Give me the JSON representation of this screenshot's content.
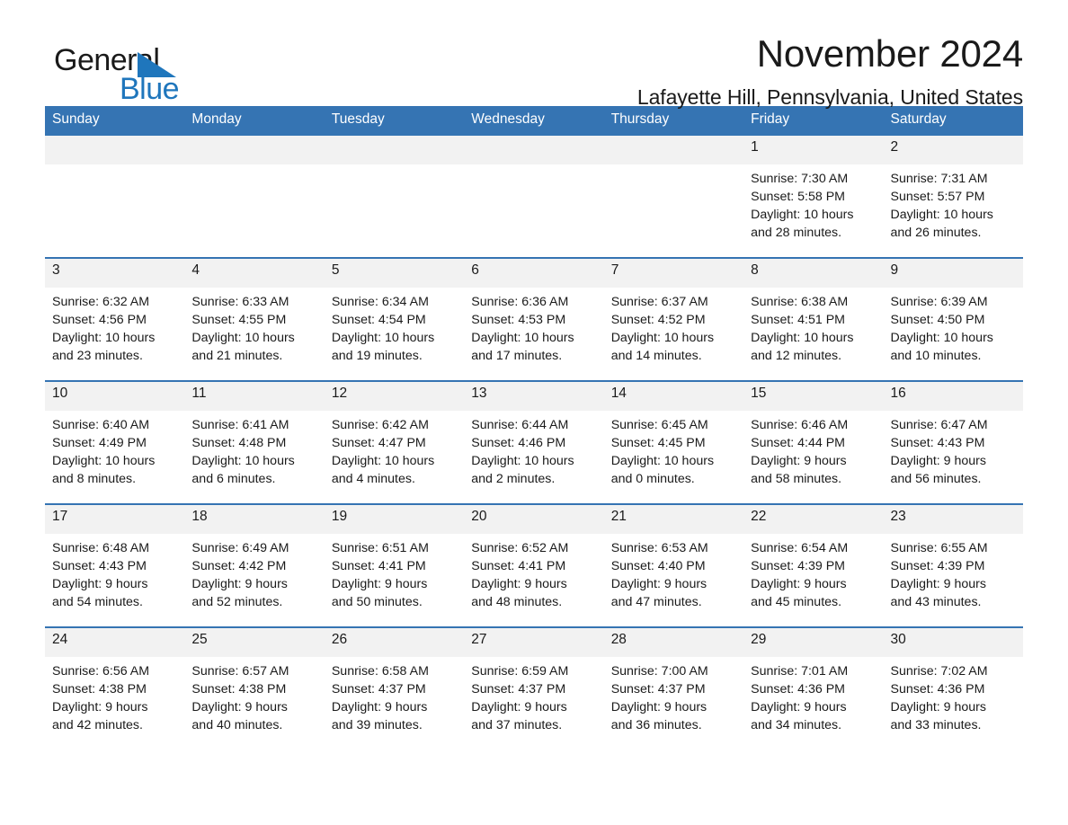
{
  "brand": {
    "name_part1": "General",
    "name_part2": "Blue",
    "accent_color": "#1f76bc",
    "triangle_icon": "triangle-icon"
  },
  "header": {
    "month_title": "November 2024",
    "location": "Lafayette Hill, Pennsylvania, United States"
  },
  "calendar": {
    "header_bg": "#3574b3",
    "daynum_bg": "#f2f2f2",
    "weekday_headers": [
      "Sunday",
      "Monday",
      "Tuesday",
      "Wednesday",
      "Thursday",
      "Friday",
      "Saturday"
    ],
    "weeks": [
      [
        {
          "day": "",
          "sunrise": "",
          "sunset": "",
          "daylight_line1": "",
          "daylight_line2": ""
        },
        {
          "day": "",
          "sunrise": "",
          "sunset": "",
          "daylight_line1": "",
          "daylight_line2": ""
        },
        {
          "day": "",
          "sunrise": "",
          "sunset": "",
          "daylight_line1": "",
          "daylight_line2": ""
        },
        {
          "day": "",
          "sunrise": "",
          "sunset": "",
          "daylight_line1": "",
          "daylight_line2": ""
        },
        {
          "day": "",
          "sunrise": "",
          "sunset": "",
          "daylight_line1": "",
          "daylight_line2": ""
        },
        {
          "day": "1",
          "sunrise": "Sunrise: 7:30 AM",
          "sunset": "Sunset: 5:58 PM",
          "daylight_line1": "Daylight: 10 hours",
          "daylight_line2": "and 28 minutes."
        },
        {
          "day": "2",
          "sunrise": "Sunrise: 7:31 AM",
          "sunset": "Sunset: 5:57 PM",
          "daylight_line1": "Daylight: 10 hours",
          "daylight_line2": "and 26 minutes."
        }
      ],
      [
        {
          "day": "3",
          "sunrise": "Sunrise: 6:32 AM",
          "sunset": "Sunset: 4:56 PM",
          "daylight_line1": "Daylight: 10 hours",
          "daylight_line2": "and 23 minutes."
        },
        {
          "day": "4",
          "sunrise": "Sunrise: 6:33 AM",
          "sunset": "Sunset: 4:55 PM",
          "daylight_line1": "Daylight: 10 hours",
          "daylight_line2": "and 21 minutes."
        },
        {
          "day": "5",
          "sunrise": "Sunrise: 6:34 AM",
          "sunset": "Sunset: 4:54 PM",
          "daylight_line1": "Daylight: 10 hours",
          "daylight_line2": "and 19 minutes."
        },
        {
          "day": "6",
          "sunrise": "Sunrise: 6:36 AM",
          "sunset": "Sunset: 4:53 PM",
          "daylight_line1": "Daylight: 10 hours",
          "daylight_line2": "and 17 minutes."
        },
        {
          "day": "7",
          "sunrise": "Sunrise: 6:37 AM",
          "sunset": "Sunset: 4:52 PM",
          "daylight_line1": "Daylight: 10 hours",
          "daylight_line2": "and 14 minutes."
        },
        {
          "day": "8",
          "sunrise": "Sunrise: 6:38 AM",
          "sunset": "Sunset: 4:51 PM",
          "daylight_line1": "Daylight: 10 hours",
          "daylight_line2": "and 12 minutes."
        },
        {
          "day": "9",
          "sunrise": "Sunrise: 6:39 AM",
          "sunset": "Sunset: 4:50 PM",
          "daylight_line1": "Daylight: 10 hours",
          "daylight_line2": "and 10 minutes."
        }
      ],
      [
        {
          "day": "10",
          "sunrise": "Sunrise: 6:40 AM",
          "sunset": "Sunset: 4:49 PM",
          "daylight_line1": "Daylight: 10 hours",
          "daylight_line2": "and 8 minutes."
        },
        {
          "day": "11",
          "sunrise": "Sunrise: 6:41 AM",
          "sunset": "Sunset: 4:48 PM",
          "daylight_line1": "Daylight: 10 hours",
          "daylight_line2": "and 6 minutes."
        },
        {
          "day": "12",
          "sunrise": "Sunrise: 6:42 AM",
          "sunset": "Sunset: 4:47 PM",
          "daylight_line1": "Daylight: 10 hours",
          "daylight_line2": "and 4 minutes."
        },
        {
          "day": "13",
          "sunrise": "Sunrise: 6:44 AM",
          "sunset": "Sunset: 4:46 PM",
          "daylight_line1": "Daylight: 10 hours",
          "daylight_line2": "and 2 minutes."
        },
        {
          "day": "14",
          "sunrise": "Sunrise: 6:45 AM",
          "sunset": "Sunset: 4:45 PM",
          "daylight_line1": "Daylight: 10 hours",
          "daylight_line2": "and 0 minutes."
        },
        {
          "day": "15",
          "sunrise": "Sunrise: 6:46 AM",
          "sunset": "Sunset: 4:44 PM",
          "daylight_line1": "Daylight: 9 hours",
          "daylight_line2": "and 58 minutes."
        },
        {
          "day": "16",
          "sunrise": "Sunrise: 6:47 AM",
          "sunset": "Sunset: 4:43 PM",
          "daylight_line1": "Daylight: 9 hours",
          "daylight_line2": "and 56 minutes."
        }
      ],
      [
        {
          "day": "17",
          "sunrise": "Sunrise: 6:48 AM",
          "sunset": "Sunset: 4:43 PM",
          "daylight_line1": "Daylight: 9 hours",
          "daylight_line2": "and 54 minutes."
        },
        {
          "day": "18",
          "sunrise": "Sunrise: 6:49 AM",
          "sunset": "Sunset: 4:42 PM",
          "daylight_line1": "Daylight: 9 hours",
          "daylight_line2": "and 52 minutes."
        },
        {
          "day": "19",
          "sunrise": "Sunrise: 6:51 AM",
          "sunset": "Sunset: 4:41 PM",
          "daylight_line1": "Daylight: 9 hours",
          "daylight_line2": "and 50 minutes."
        },
        {
          "day": "20",
          "sunrise": "Sunrise: 6:52 AM",
          "sunset": "Sunset: 4:41 PM",
          "daylight_line1": "Daylight: 9 hours",
          "daylight_line2": "and 48 minutes."
        },
        {
          "day": "21",
          "sunrise": "Sunrise: 6:53 AM",
          "sunset": "Sunset: 4:40 PM",
          "daylight_line1": "Daylight: 9 hours",
          "daylight_line2": "and 47 minutes."
        },
        {
          "day": "22",
          "sunrise": "Sunrise: 6:54 AM",
          "sunset": "Sunset: 4:39 PM",
          "daylight_line1": "Daylight: 9 hours",
          "daylight_line2": "and 45 minutes."
        },
        {
          "day": "23",
          "sunrise": "Sunrise: 6:55 AM",
          "sunset": "Sunset: 4:39 PM",
          "daylight_line1": "Daylight: 9 hours",
          "daylight_line2": "and 43 minutes."
        }
      ],
      [
        {
          "day": "24",
          "sunrise": "Sunrise: 6:56 AM",
          "sunset": "Sunset: 4:38 PM",
          "daylight_line1": "Daylight: 9 hours",
          "daylight_line2": "and 42 minutes."
        },
        {
          "day": "25",
          "sunrise": "Sunrise: 6:57 AM",
          "sunset": "Sunset: 4:38 PM",
          "daylight_line1": "Daylight: 9 hours",
          "daylight_line2": "and 40 minutes."
        },
        {
          "day": "26",
          "sunrise": "Sunrise: 6:58 AM",
          "sunset": "Sunset: 4:37 PM",
          "daylight_line1": "Daylight: 9 hours",
          "daylight_line2": "and 39 minutes."
        },
        {
          "day": "27",
          "sunrise": "Sunrise: 6:59 AM",
          "sunset": "Sunset: 4:37 PM",
          "daylight_line1": "Daylight: 9 hours",
          "daylight_line2": "and 37 minutes."
        },
        {
          "day": "28",
          "sunrise": "Sunrise: 7:00 AM",
          "sunset": "Sunset: 4:37 PM",
          "daylight_line1": "Daylight: 9 hours",
          "daylight_line2": "and 36 minutes."
        },
        {
          "day": "29",
          "sunrise": "Sunrise: 7:01 AM",
          "sunset": "Sunset: 4:36 PM",
          "daylight_line1": "Daylight: 9 hours",
          "daylight_line2": "and 34 minutes."
        },
        {
          "day": "30",
          "sunrise": "Sunrise: 7:02 AM",
          "sunset": "Sunset: 4:36 PM",
          "daylight_line1": "Daylight: 9 hours",
          "daylight_line2": "and 33 minutes."
        }
      ]
    ]
  }
}
